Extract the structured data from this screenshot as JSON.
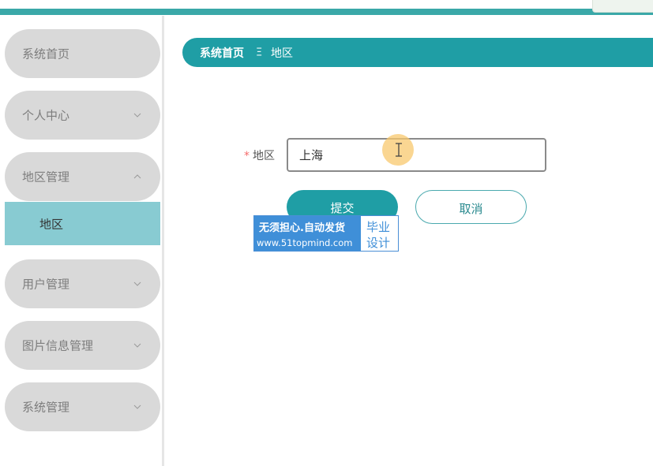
{
  "sidebar": {
    "items": [
      {
        "label": "系统首页",
        "expandable": false
      },
      {
        "label": "个人中心",
        "expandable": true,
        "expanded": false
      },
      {
        "label": "地区管理",
        "expandable": true,
        "expanded": true
      },
      {
        "label": "用户管理",
        "expandable": true,
        "expanded": false
      },
      {
        "label": "图片信息管理",
        "expandable": true,
        "expanded": false
      },
      {
        "label": "系统管理",
        "expandable": true,
        "expanded": false
      }
    ],
    "subitems": [
      {
        "label": "地区",
        "active": true
      }
    ]
  },
  "breadcrumb": {
    "home": "系统首页",
    "separator": "Ξ",
    "current": "地区"
  },
  "form": {
    "required_mark": "*",
    "region_label": "地区",
    "region_value": "上海",
    "submit_label": "提交",
    "cancel_label": "取消"
  },
  "watermark": {
    "line1": "无须担心.自动发货",
    "line2": "www.51topmind.com",
    "right1": "毕业",
    "right2": "设计"
  },
  "colors": {
    "accent": "#1f9ea5",
    "sidebar_item_bg": "#d9d9d9",
    "active_subitem_bg": "#88cbd2",
    "required": "#f56c6c"
  }
}
